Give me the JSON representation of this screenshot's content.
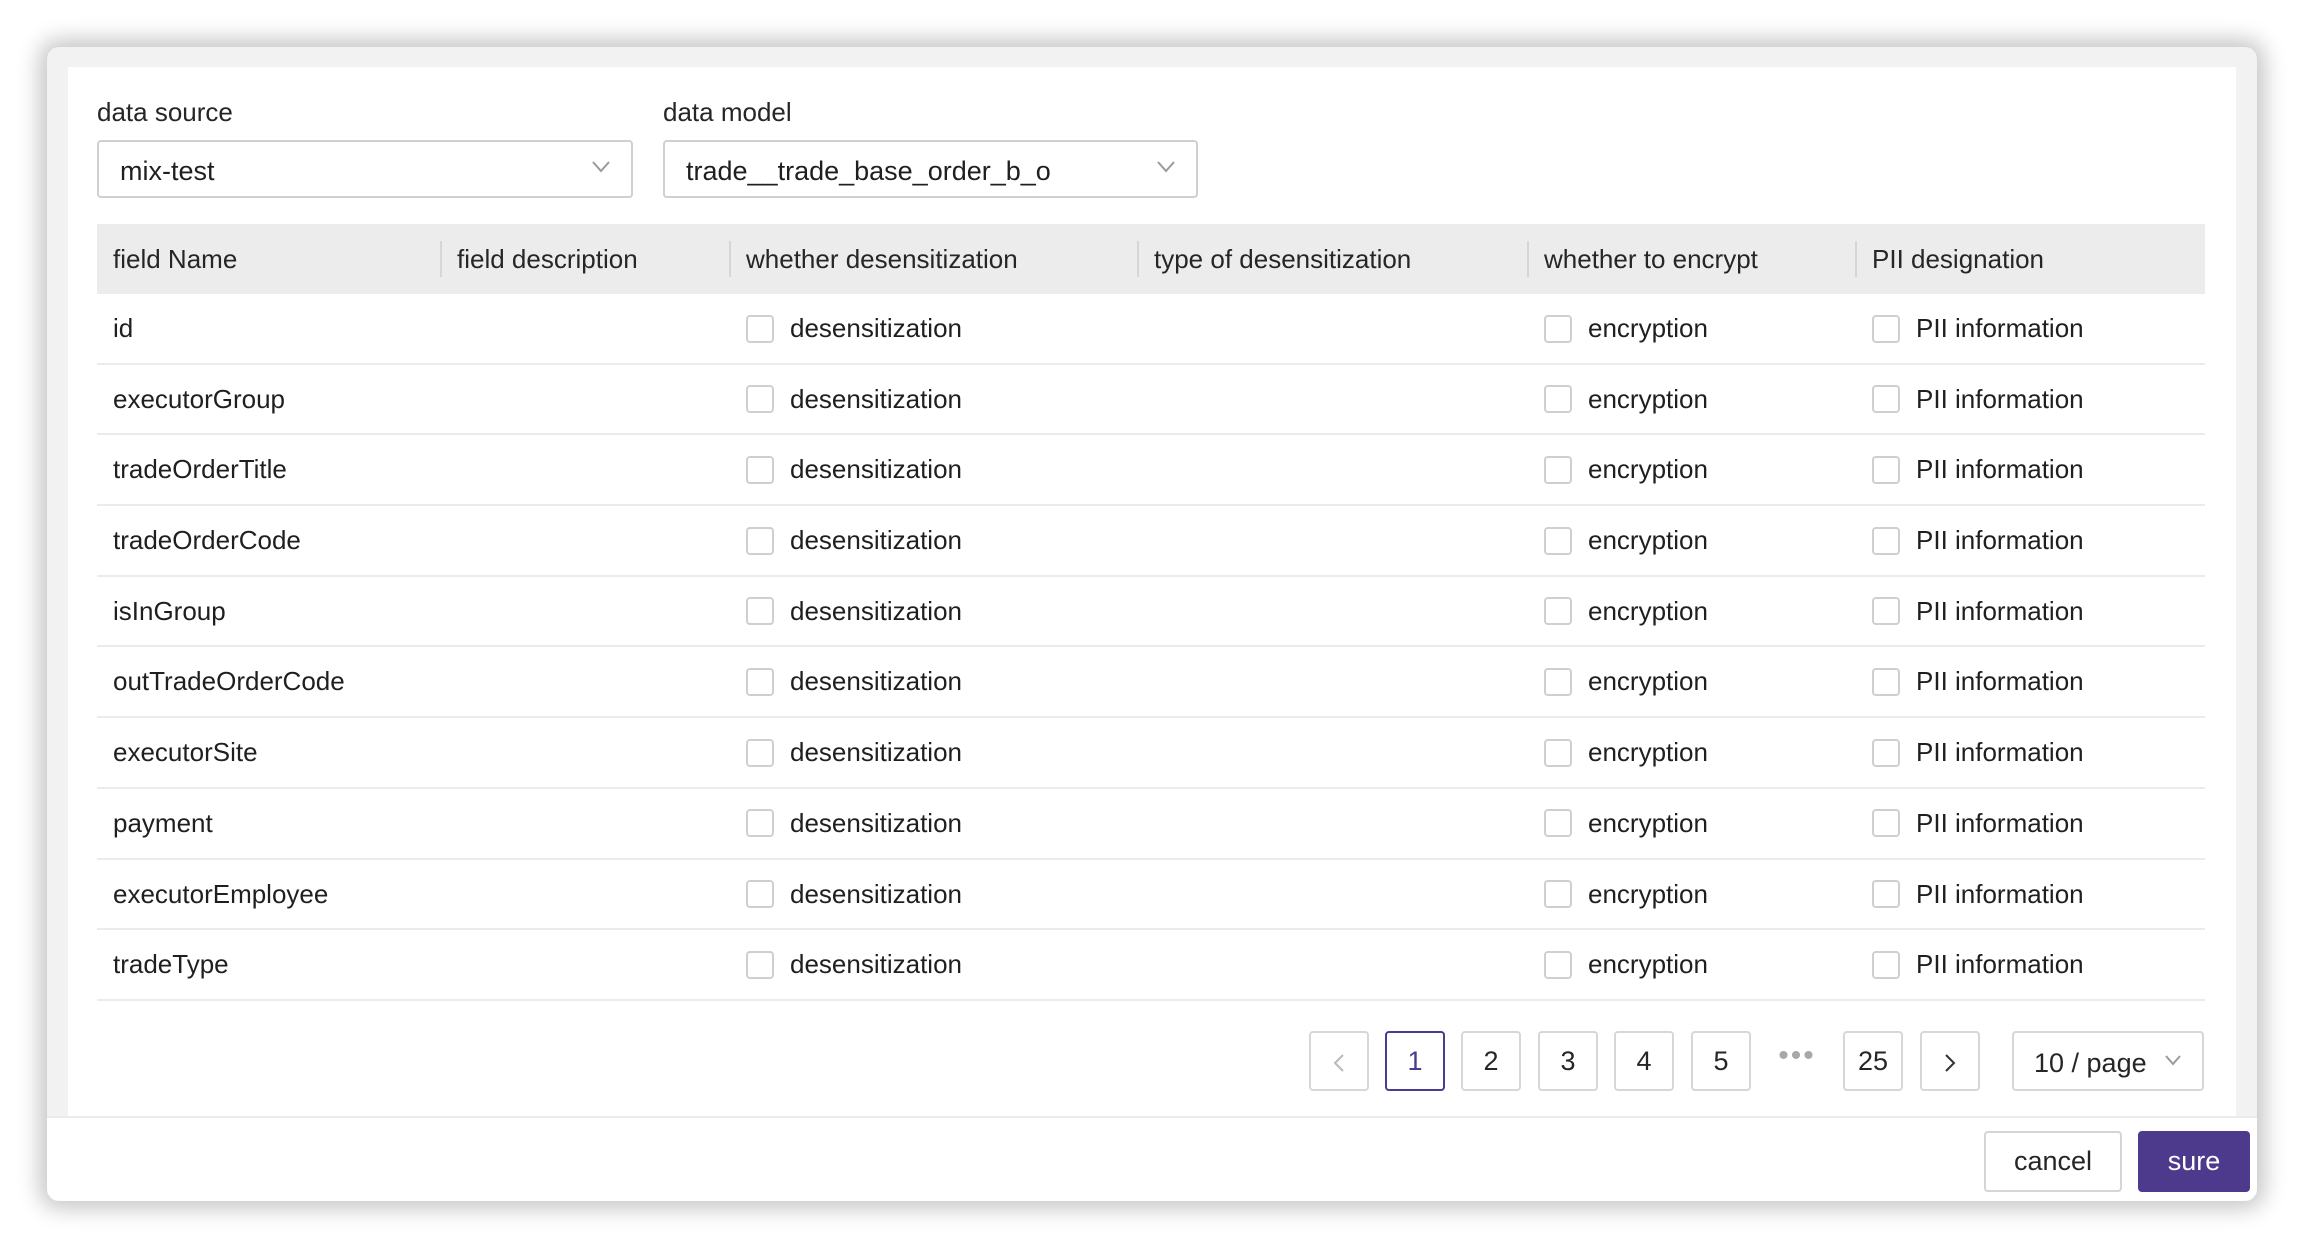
{
  "form": {
    "data_source": {
      "label": "data source",
      "value": "mix-test"
    },
    "data_model": {
      "label": "data model",
      "value": "trade__trade_base_order_b_o"
    }
  },
  "table": {
    "columns": [
      "field Name",
      "field description",
      "whether desensitization",
      "type of desensitization",
      "whether to encrypt",
      "PII designation"
    ],
    "checkbox_labels": {
      "desensitization": "desensitization",
      "encryption": "encryption",
      "pii": "PII information"
    },
    "rows": [
      {
        "field_name": "id",
        "field_description": "",
        "desensitization_checked": false,
        "type_of_desensitization": "",
        "encryption_checked": false,
        "pii_checked": false
      },
      {
        "field_name": "executorGroup",
        "field_description": "",
        "desensitization_checked": false,
        "type_of_desensitization": "",
        "encryption_checked": false,
        "pii_checked": false
      },
      {
        "field_name": "tradeOrderTitle",
        "field_description": "",
        "desensitization_checked": false,
        "type_of_desensitization": "",
        "encryption_checked": false,
        "pii_checked": false
      },
      {
        "field_name": "tradeOrderCode",
        "field_description": "",
        "desensitization_checked": false,
        "type_of_desensitization": "",
        "encryption_checked": false,
        "pii_checked": false
      },
      {
        "field_name": "isInGroup",
        "field_description": "",
        "desensitization_checked": false,
        "type_of_desensitization": "",
        "encryption_checked": false,
        "pii_checked": false
      },
      {
        "field_name": "outTradeOrderCode",
        "field_description": "",
        "desensitization_checked": false,
        "type_of_desensitization": "",
        "encryption_checked": false,
        "pii_checked": false
      },
      {
        "field_name": "executorSite",
        "field_description": "",
        "desensitization_checked": false,
        "type_of_desensitization": "",
        "encryption_checked": false,
        "pii_checked": false
      },
      {
        "field_name": "payment",
        "field_description": "",
        "desensitization_checked": false,
        "type_of_desensitization": "",
        "encryption_checked": false,
        "pii_checked": false
      },
      {
        "field_name": "executorEmployee",
        "field_description": "",
        "desensitization_checked": false,
        "type_of_desensitization": "",
        "encryption_checked": false,
        "pii_checked": false
      },
      {
        "field_name": "tradeType",
        "field_description": "",
        "desensitization_checked": false,
        "type_of_desensitization": "",
        "encryption_checked": false,
        "pii_checked": false
      }
    ]
  },
  "pagination": {
    "prev_icon": "chevron-left-icon",
    "next_icon": "chevron-right-icon",
    "prev_label": "<",
    "next_label": ">",
    "pages": [
      "1",
      "2",
      "3",
      "4",
      "5"
    ],
    "ellipsis": "•••",
    "last_page": "25",
    "current_page": "1",
    "page_size": "10 / page"
  },
  "footer": {
    "cancel_label": "cancel",
    "sure_label": "sure"
  },
  "colors": {
    "accent": "#4e3a8c",
    "header_bg": "#ececec",
    "border": "#d7d7d7"
  }
}
